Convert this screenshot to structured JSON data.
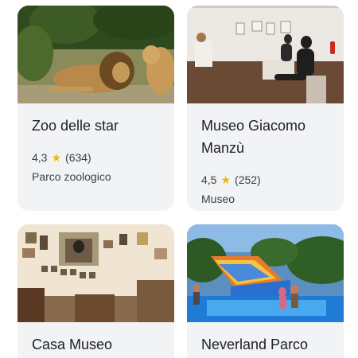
{
  "cards": [
    {
      "title": "Zoo delle star",
      "rating": "4,3",
      "reviews": "(634)",
      "category": "Parco zoologico"
    },
    {
      "title": "Museo Giacomo Manzù",
      "rating": "4,5",
      "reviews": "(252)",
      "category": "Museo"
    },
    {
      "title": "Casa Museo"
    },
    {
      "title": "Neverland Parco"
    }
  ],
  "colors": {
    "card_bg": "#f1f3f4",
    "star": "#f4b400",
    "title": "#202124",
    "text": "#3c4043"
  },
  "icons": {
    "star": "star-icon"
  }
}
